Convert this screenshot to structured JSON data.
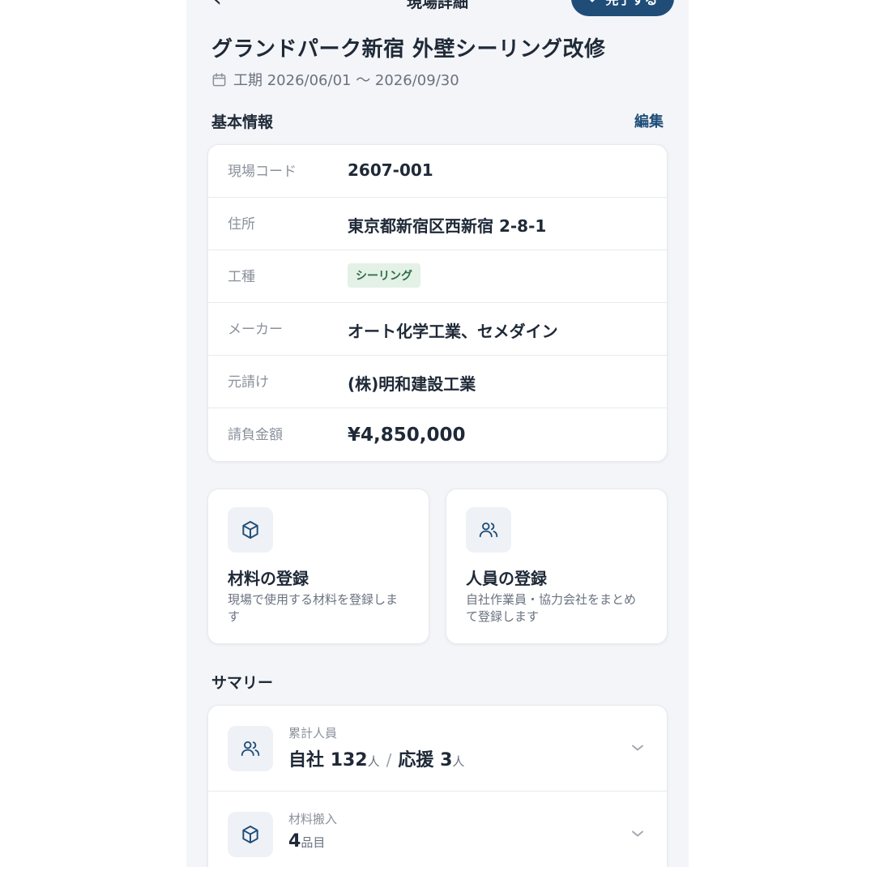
{
  "nav": {
    "title": "現場詳細",
    "done_button": "完了する"
  },
  "site": {
    "title": "グランドパーク新宿 外壁シーリング改修",
    "period": "工期 2026/06/01 〜 2026/09/30"
  },
  "basic_info": {
    "heading": "基本情報",
    "edit_label": "編集",
    "rows": [
      {
        "label": "現場コード",
        "value": "2607-001"
      },
      {
        "label": "住所",
        "value": "東京都新宿区西新宿 2-8-1"
      },
      {
        "label": "工種",
        "value": "シーリング"
      },
      {
        "label": "メーカー",
        "value": "オート化学工業、セメダイン"
      },
      {
        "label": "元請け",
        "value": "(株)明和建設工業"
      },
      {
        "label": "請負金額",
        "value": "¥4,850,000"
      }
    ]
  },
  "actions": [
    {
      "title": "材料の登録",
      "description": "現場で使用する材料を登録します",
      "icon": "box-icon"
    },
    {
      "title": "人員の登録",
      "description": "自社作業員・協力会社をまとめて登録します",
      "icon": "people-icon"
    }
  ],
  "summary": {
    "heading": "サマリー",
    "people": {
      "label": "累計人員",
      "own_label": "自社",
      "own_count": "132",
      "support_label": "応援",
      "support_count": "3",
      "unit": "人"
    },
    "materials": {
      "label": "材料搬入",
      "count": "4",
      "unit": "品目"
    }
  },
  "colors": {
    "primary": "#1f4d78",
    "background": "#f3f5f8",
    "tag_bg": "#e3f1e7",
    "tag_text": "#2e6b43"
  }
}
